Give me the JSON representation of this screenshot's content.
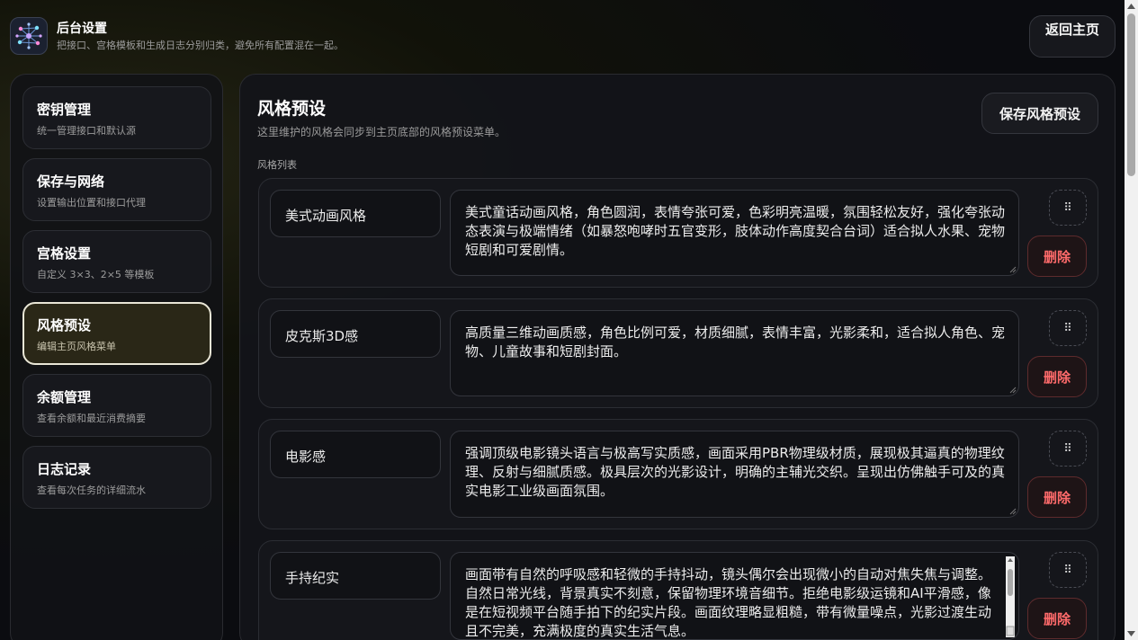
{
  "header": {
    "title": "后台设置",
    "subtitle": "把接口、宫格模板和生成日志分别归类，避免所有配置混在一起。",
    "back_label": "返回主页",
    "logo_icon": "network-graph-icon"
  },
  "sidebar": {
    "items": [
      {
        "title": "密钥管理",
        "desc": "统一管理接口和默认源",
        "active": false
      },
      {
        "title": "保存与网络",
        "desc": "设置输出位置和接口代理",
        "active": false
      },
      {
        "title": "宫格设置",
        "desc": "自定义 3×3、2×5 等模板",
        "active": false
      },
      {
        "title": "风格预设",
        "desc": "编辑主页风格菜单",
        "active": true
      },
      {
        "title": "余额管理",
        "desc": "查看余额和最近消费摘要",
        "active": false
      },
      {
        "title": "日志记录",
        "desc": "查看每次任务的详细流水",
        "active": false
      }
    ]
  },
  "main": {
    "title": "风格预设",
    "subtitle": "这里维护的风格会同步到主页底部的风格预设菜单。",
    "save_label": "保存风格预设",
    "list_label": "风格列表",
    "drag_glyph": "⠿",
    "delete_label": "删除",
    "styles": [
      {
        "name": "美式动画风格",
        "desc": "美式童话动画风格，角色圆润，表情夸张可爱，色彩明亮温暖，氛围轻松友好，强化夸张动态表演与极端情绪（如暴怒咆哮时五官变形，肢体动作高度契合台词）适合拟人水果、宠物短剧和可爱剧情。"
      },
      {
        "name": "皮克斯3D感",
        "desc": "高质量三维动画质感，角色比例可爱，材质细腻，表情丰富，光影柔和，适合拟人角色、宠物、儿童故事和短剧封面。"
      },
      {
        "name": "电影感",
        "desc": "强调顶级电影镜头语言与极高写实质感，画面采用PBR物理级材质，展现极其逼真的物理纹理、反射与细腻质感。极具层次的光影设计，明确的主辅光交织。呈现出仿佛触手可及的真实电影工业级画面氛围。"
      },
      {
        "name": "手持纪实",
        "desc": "画面带有自然的呼吸感和轻微的手持抖动，镜头偶尔会出现微小的自动对焦失焦与调整。自然日常光线，背景真实不刻意，保留物理环境音细节。拒绝电影级运镜和AI平滑感，像是在短视频平台随手拍下的纪实片段。画面纹理略显粗糙，带有微量噪点，光影过渡生动且不完美，充满极度的真实生活气息。"
      }
    ]
  },
  "colors": {
    "accent_active_border": "#e9e6d6",
    "delete_text": "#ff6b6b",
    "delete_border": "#5e2b2d"
  }
}
